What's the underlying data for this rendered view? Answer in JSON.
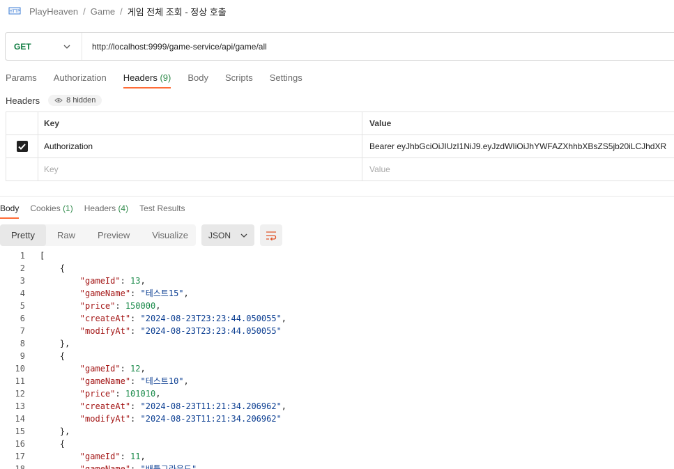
{
  "breadcrumb": {
    "icon": "http-icon",
    "items": [
      "PlayHeaven",
      "Game"
    ],
    "separator": "/",
    "current": "게임 전체 조회 - 정상 호출"
  },
  "request": {
    "method": "GET",
    "url": "http://localhost:9999/game-service/api/game/all"
  },
  "request_tabs": [
    {
      "label": "Params",
      "count": ""
    },
    {
      "label": "Authorization",
      "count": ""
    },
    {
      "label": "Headers",
      "count": "(9)"
    },
    {
      "label": "Body",
      "count": ""
    },
    {
      "label": "Scripts",
      "count": ""
    },
    {
      "label": "Settings",
      "count": ""
    }
  ],
  "headers": {
    "label": "Headers",
    "hidden_count": "8 hidden",
    "columns": {
      "key": "Key",
      "value": "Value"
    },
    "rows": [
      {
        "checked": true,
        "key": "Authorization",
        "value": "Bearer eyJhbGciOiJIUzI1NiJ9.eyJzdWIiOiJhYWFAZXhhbXBsZS5jb20iLCJhdXR"
      }
    ],
    "placeholder": {
      "key": "Key",
      "value": "Value"
    }
  },
  "response_tabs": [
    {
      "label": "Body",
      "count": ""
    },
    {
      "label": "Cookies",
      "count": "(1)"
    },
    {
      "label": "Headers",
      "count": "(4)"
    },
    {
      "label": "Test Results",
      "count": ""
    }
  ],
  "view_modes": [
    "Pretty",
    "Raw",
    "Preview",
    "Visualize"
  ],
  "format": "JSON",
  "code_lines": [
    [
      {
        "t": "p",
        "v": "["
      }
    ],
    [
      {
        "t": "p",
        "v": "    {"
      }
    ],
    [
      {
        "t": "p",
        "v": "        "
      },
      {
        "t": "k",
        "v": "\"gameId\""
      },
      {
        "t": "p",
        "v": ": "
      },
      {
        "t": "n",
        "v": "13"
      },
      {
        "t": "p",
        "v": ","
      }
    ],
    [
      {
        "t": "p",
        "v": "        "
      },
      {
        "t": "k",
        "v": "\"gameName\""
      },
      {
        "t": "p",
        "v": ": "
      },
      {
        "t": "s",
        "v": "\"테스트15\""
      },
      {
        "t": "p",
        "v": ","
      }
    ],
    [
      {
        "t": "p",
        "v": "        "
      },
      {
        "t": "k",
        "v": "\"price\""
      },
      {
        "t": "p",
        "v": ": "
      },
      {
        "t": "n",
        "v": "150000"
      },
      {
        "t": "p",
        "v": ","
      }
    ],
    [
      {
        "t": "p",
        "v": "        "
      },
      {
        "t": "k",
        "v": "\"createAt\""
      },
      {
        "t": "p",
        "v": ": "
      },
      {
        "t": "s",
        "v": "\"2024-08-23T23:23:44.050055\""
      },
      {
        "t": "p",
        "v": ","
      }
    ],
    [
      {
        "t": "p",
        "v": "        "
      },
      {
        "t": "k",
        "v": "\"modifyAt\""
      },
      {
        "t": "p",
        "v": ": "
      },
      {
        "t": "s",
        "v": "\"2024-08-23T23:23:44.050055\""
      }
    ],
    [
      {
        "t": "p",
        "v": "    },"
      }
    ],
    [
      {
        "t": "p",
        "v": "    {"
      }
    ],
    [
      {
        "t": "p",
        "v": "        "
      },
      {
        "t": "k",
        "v": "\"gameId\""
      },
      {
        "t": "p",
        "v": ": "
      },
      {
        "t": "n",
        "v": "12"
      },
      {
        "t": "p",
        "v": ","
      }
    ],
    [
      {
        "t": "p",
        "v": "        "
      },
      {
        "t": "k",
        "v": "\"gameName\""
      },
      {
        "t": "p",
        "v": ": "
      },
      {
        "t": "s",
        "v": "\"테스트10\""
      },
      {
        "t": "p",
        "v": ","
      }
    ],
    [
      {
        "t": "p",
        "v": "        "
      },
      {
        "t": "k",
        "v": "\"price\""
      },
      {
        "t": "p",
        "v": ": "
      },
      {
        "t": "n",
        "v": "101010"
      },
      {
        "t": "p",
        "v": ","
      }
    ],
    [
      {
        "t": "p",
        "v": "        "
      },
      {
        "t": "k",
        "v": "\"createAt\""
      },
      {
        "t": "p",
        "v": ": "
      },
      {
        "t": "s",
        "v": "\"2024-08-23T11:21:34.206962\""
      },
      {
        "t": "p",
        "v": ","
      }
    ],
    [
      {
        "t": "p",
        "v": "        "
      },
      {
        "t": "k",
        "v": "\"modifyAt\""
      },
      {
        "t": "p",
        "v": ": "
      },
      {
        "t": "s",
        "v": "\"2024-08-23T11:21:34.206962\""
      }
    ],
    [
      {
        "t": "p",
        "v": "    },"
      }
    ],
    [
      {
        "t": "p",
        "v": "    {"
      }
    ],
    [
      {
        "t": "p",
        "v": "        "
      },
      {
        "t": "k",
        "v": "\"gameId\""
      },
      {
        "t": "p",
        "v": ": "
      },
      {
        "t": "n",
        "v": "11"
      },
      {
        "t": "p",
        "v": ","
      }
    ],
    [
      {
        "t": "p",
        "v": "        "
      },
      {
        "t": "k",
        "v": "\"gameName\""
      },
      {
        "t": "p",
        "v": ": "
      },
      {
        "t": "s",
        "v": "\"배틀그라운드\""
      }
    ]
  ],
  "colors": {
    "accent": "#ff6c37",
    "method": "#0b7a3e",
    "key": "#a31515",
    "string": "#0a3d91",
    "number": "#1a8a4a"
  }
}
